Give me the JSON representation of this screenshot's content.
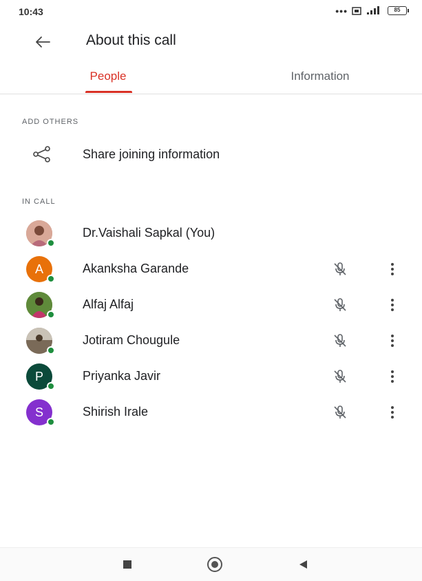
{
  "status_bar": {
    "time": "10:43",
    "battery": "85"
  },
  "app_bar": {
    "title": "About this call",
    "back_icon": "arrow-back-icon"
  },
  "tabs": [
    {
      "label": "People",
      "active": true
    },
    {
      "label": "Information",
      "active": false
    }
  ],
  "sections": {
    "add_others": "ADD OTHERS",
    "in_call": "IN CALL"
  },
  "share": {
    "label": "Share joining information",
    "icon": "share-icon"
  },
  "participants": [
    {
      "name": "Dr.Vaishali Sapkal (You)",
      "avatar_type": "photo",
      "initial": "",
      "color": "#c48a7a",
      "muted": false
    },
    {
      "name": "Akanksha Garande",
      "avatar_type": "initial",
      "initial": "A",
      "color": "#e8710a",
      "muted": true
    },
    {
      "name": "Alfaj Alfaj",
      "avatar_type": "photo",
      "initial": "",
      "color": "#6b8e3a",
      "muted": true
    },
    {
      "name": "Jotiram Chougule",
      "avatar_type": "photo",
      "initial": "",
      "color": "#8a7a68",
      "muted": true
    },
    {
      "name": "Priyanka Javir",
      "avatar_type": "initial",
      "initial": "P",
      "color": "#0b4a3a",
      "muted": true
    },
    {
      "name": "Shirish Irale",
      "avatar_type": "initial",
      "initial": "S",
      "color": "#8430ce",
      "muted": true
    }
  ],
  "colors": {
    "accent": "#d93025",
    "online": "#1e8e3e"
  }
}
